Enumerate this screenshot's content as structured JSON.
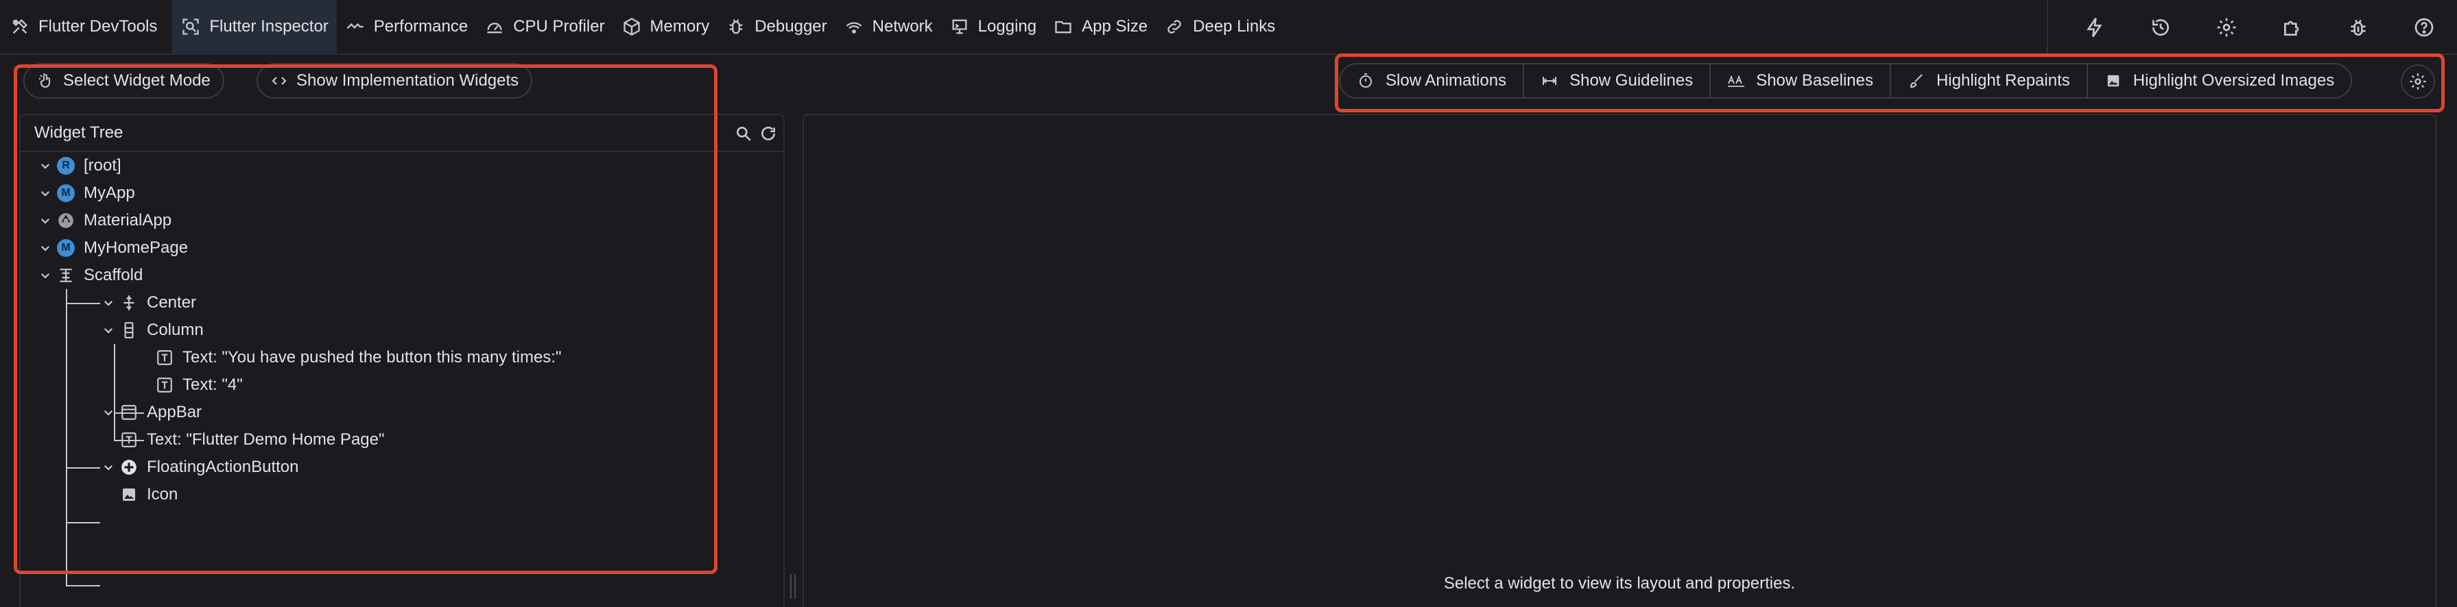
{
  "nav": {
    "app_title": "Flutter DevTools",
    "tabs": [
      {
        "label": "Flutter Inspector",
        "icon": "inspector-icon",
        "active": true
      },
      {
        "label": "Performance",
        "icon": "performance-icon"
      },
      {
        "label": "CPU Profiler",
        "icon": "cpu-profiler-icon"
      },
      {
        "label": "Memory",
        "icon": "memory-icon"
      },
      {
        "label": "Debugger",
        "icon": "debugger-icon"
      },
      {
        "label": "Network",
        "icon": "network-icon"
      },
      {
        "label": "Logging",
        "icon": "logging-icon"
      },
      {
        "label": "App Size",
        "icon": "app-size-icon"
      },
      {
        "label": "Deep Links",
        "icon": "deep-links-icon"
      }
    ],
    "right_icons": [
      "hot-reload-icon",
      "hot-restart-icon",
      "settings-icon",
      "extensions-icon",
      "report-bug-icon",
      "help-icon"
    ]
  },
  "inspector": {
    "select_widget_mode": "Select Widget Mode",
    "show_implementation_widgets": "Show Implementation Widgets",
    "toolbar": {
      "slow_animations": "Slow Animations",
      "show_guidelines": "Show Guidelines",
      "show_baselines": "Show Baselines",
      "highlight_repaints": "Highlight Repaints",
      "highlight_oversized_images": "Highlight Oversized Images"
    },
    "widget_tree_title": "Widget Tree",
    "tree": [
      {
        "label": "[root]",
        "icon": "R",
        "expanded": true
      },
      {
        "label": "MyApp",
        "icon": "M",
        "expanded": true
      },
      {
        "label": "MaterialApp",
        "icon": "material-app-icon",
        "expanded": true
      },
      {
        "label": "MyHomePage",
        "icon": "M",
        "expanded": true
      },
      {
        "label": "Scaffold",
        "icon": "scaffold-icon",
        "expanded": true
      },
      {
        "label": "Center",
        "icon": "center-icon",
        "expanded": true
      },
      {
        "label": "Column",
        "icon": "column-icon",
        "expanded": true
      },
      {
        "label": "Text: \"You have pushed the button this many times:\"",
        "icon": "text-icon"
      },
      {
        "label": "Text: \"4\"",
        "icon": "text-icon"
      },
      {
        "label": "AppBar",
        "icon": "appbar-icon",
        "expanded": true
      },
      {
        "label": "Text: \"Flutter Demo Home Page\"",
        "icon": "text-icon"
      },
      {
        "label": "FloatingActionButton",
        "icon": "fab-icon",
        "expanded": true
      },
      {
        "label": "Icon",
        "icon": "image-icon"
      }
    ],
    "details_placeholder": "Select a widget to view its layout and properties."
  },
  "colors": {
    "background": "#1b1b1f",
    "text": "#e3e2e6",
    "border": "#3a3a40",
    "active_tab": "#262d3a",
    "badge": "#3d8fd6",
    "highlight": "#e0452f"
  }
}
